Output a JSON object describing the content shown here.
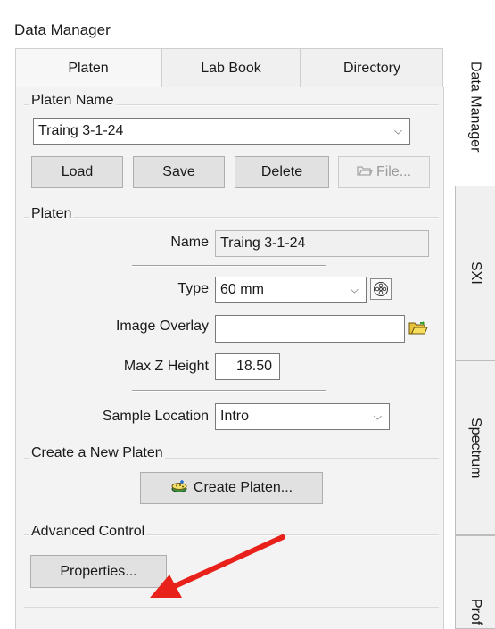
{
  "panel_title": "Data Manager",
  "tabs": [
    {
      "label": "Platen",
      "active": true
    },
    {
      "label": "Lab Book",
      "active": false
    },
    {
      "label": "Directory",
      "active": false
    }
  ],
  "side_tabs": [
    {
      "label": "Data Manager",
      "active": true
    },
    {
      "label": "SXI",
      "active": false
    },
    {
      "label": "Spectrum",
      "active": false
    },
    {
      "label": "Prof",
      "active": false
    }
  ],
  "platen_name_group": {
    "legend": "Platen Name",
    "selected": "Traing 3-1-24",
    "buttons": {
      "load": "Load",
      "save": "Save",
      "delete": "Delete",
      "file": "File..."
    }
  },
  "platen_group": {
    "legend": "Platen",
    "name_label": "Name",
    "name_value": "Traing 3-1-24",
    "type_label": "Type",
    "type_value": "60 mm",
    "overlay_label": "Image Overlay",
    "overlay_value": "",
    "maxz_label": "Max Z Height",
    "maxz_value": "18.50",
    "sample_label": "Sample Location",
    "sample_value": "Intro"
  },
  "create_group": {
    "legend": "Create a New Platen",
    "button": "Create Platen..."
  },
  "advanced_group": {
    "legend": "Advanced Control",
    "button": "Properties..."
  },
  "colors": {
    "annotation_arrow": "#e8221b",
    "tab_border": "#cfcfcf"
  },
  "icons": [
    "chevron-down-icon",
    "folder-open-icon",
    "platen-icon",
    "create-platen-icon"
  ]
}
